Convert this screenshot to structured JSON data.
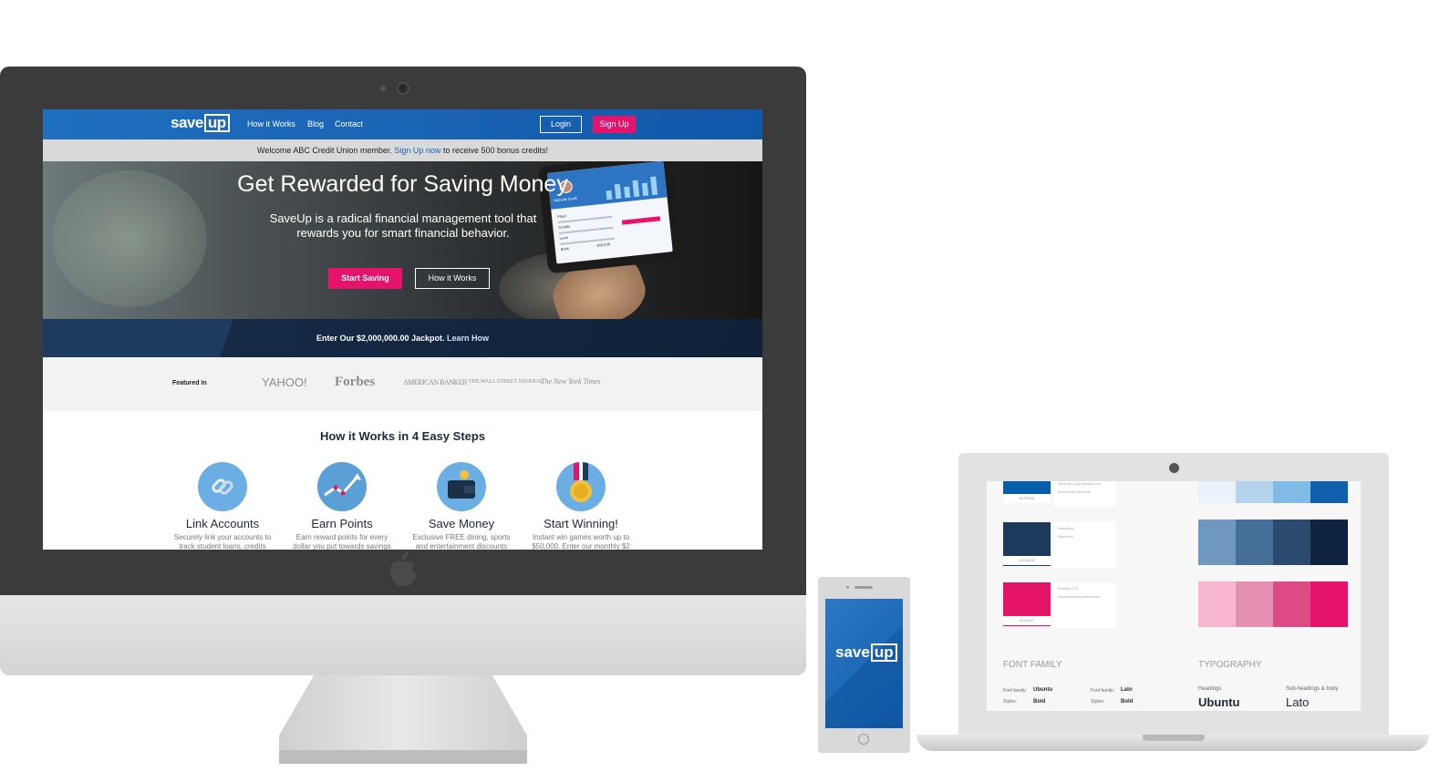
{
  "site": {
    "logo": "save",
    "logo_up": "up",
    "nav": [
      "How it Works",
      "Blog",
      "Contact"
    ],
    "login": "Login",
    "signup": "Sign Up",
    "welcome_prefix": "Welcome ABC Credit Union member.",
    "welcome_link": "Sign Up now",
    "welcome_suffix": "to receive 500 bonus credits!",
    "hero_title": "Get Rewarded for Saving Money",
    "hero_sub": "SaveUp is a radical financial management tool that rewards you for smart financial behavior.",
    "start_saving": "Start Saving",
    "how_it_works_btn": "How it Works",
    "jackpot_text": "Enter Our $2,000,000.00 Jackpot.",
    "jackpot_link": "Learn How",
    "featured_label": "Featured In",
    "press": [
      "YAHOO!",
      "Forbes",
      "AMERICAN BANKER",
      "THE WALL STREET JOURNAL",
      "The New York Times"
    ],
    "how_title": "How it Works in 4 Easy Steps",
    "steps": [
      {
        "title": "Link Accounts",
        "desc": "Securely link your accounts to track student loans, credits",
        "icon": "link-icon"
      },
      {
        "title": "Earn Points",
        "desc": "Earn reward points for every dollar you put towards savings",
        "icon": "chart-up-icon"
      },
      {
        "title": "Save Money",
        "desc": "Exclusive FREE dining, sports and entertainment discounts",
        "icon": "wallet-icon"
      },
      {
        "title": "Start Winning!",
        "desc": "Instant win games worth up to $50,000. Enter our monthly $2",
        "icon": "medal-icon"
      }
    ],
    "tablet_user": "Michelle Smith",
    "tablet_rows": [
      "Plays",
      "Credits",
      "Level",
      "Bank"
    ],
    "tablet_value": "$18,838"
  },
  "phone": {
    "logo": "save",
    "logo_up": "up"
  },
  "styleguide": {
    "swatches": [
      {
        "hex": "#075FAA",
        "notes": [
          "Reverse Logo Background",
          "Illustrative Elements"
        ],
        "color": "#075faa"
      },
      {
        "hex": "#1D3A5D",
        "notes": [
          "Headlines",
          "Body text"
        ],
        "color": "#1d3a5d"
      },
      {
        "hex": "#E51467",
        "notes": [
          "Primary CTA",
          "Illustrative elements/icons"
        ],
        "color": "#e51467"
      }
    ],
    "palettes": [
      [
        "#eaf3fb",
        "#b3d3ee",
        "#7fbbe6",
        "#1060ae"
      ],
      [
        "#7097bf",
        "#456e98",
        "#2a4b6e",
        "#0e2440"
      ],
      [
        "#f7b5d1",
        "#e58fb2",
        "#dd4b86",
        "#e5136c"
      ]
    ],
    "font_family_label": "FONT FAMILY",
    "typography_label": "TYPOGRAPHY",
    "font_family_key": "Font family:",
    "styles_key": "Styles:",
    "ubuntu": "Ubuntu",
    "lato": "Lato",
    "bold": "Bold",
    "headings": "Headings",
    "subheadings": "Sub-headings & body"
  },
  "colors": {
    "brand_blue": "#1a63b3",
    "brand_pink": "#e5136c",
    "navy": "#1d3a5d"
  }
}
